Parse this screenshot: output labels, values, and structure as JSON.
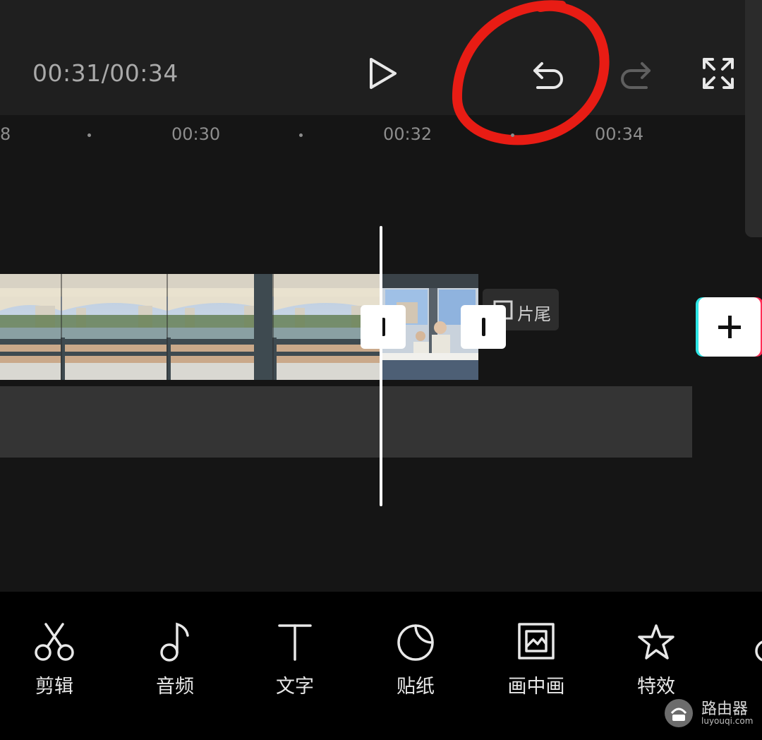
{
  "player": {
    "time": "00:31/00:34"
  },
  "ruler": {
    "ticks": [
      "8",
      "00:30",
      "00:32",
      "00:34"
    ]
  },
  "track": {
    "ending_label": "片尾"
  },
  "toolbar": {
    "items": [
      {
        "label": "剪辑",
        "icon": "scissors-icon"
      },
      {
        "label": "音频",
        "icon": "music-note-icon"
      },
      {
        "label": "文字",
        "icon": "text-icon"
      },
      {
        "label": "贴纸",
        "icon": "sticker-icon"
      },
      {
        "label": "画中画",
        "icon": "picture-in-picture-icon"
      },
      {
        "label": "特效",
        "icon": "effects-star-icon"
      }
    ]
  },
  "watermark": {
    "text": "路由器",
    "sub": "luyouqi.com"
  },
  "colors": {
    "annotation_circle": "#e81c14",
    "add_button_cyan": "#2ee6e6",
    "add_button_pink": "#ff2d55"
  }
}
